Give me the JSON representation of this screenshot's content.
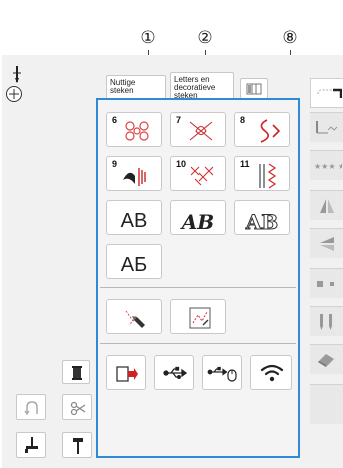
{
  "callouts": [
    "①",
    "②",
    "⑧"
  ],
  "top_tabs": {
    "utility": "Nuttige\nsteken",
    "letters": "Letters en\ndecoratieve\nsteken"
  },
  "stitch_categories": [
    {
      "number": "6",
      "icon": "decorative-flower-stitch-icon"
    },
    {
      "number": "7",
      "icon": "decorative-heart-stitch-icon"
    },
    {
      "number": "8",
      "icon": "decorative-scroll-stitch-icon"
    },
    {
      "number": "9",
      "icon": "satin-stitch-icon"
    },
    {
      "number": "10",
      "icon": "cross-stitch-icon"
    },
    {
      "number": "11",
      "icon": "zigzag-stitch-icon"
    }
  ],
  "fonts": [
    {
      "label": "AB",
      "style": "block"
    },
    {
      "label": "AB",
      "style": "script"
    },
    {
      "label": "AB",
      "style": "outline"
    },
    {
      "label": "АБ",
      "style": "cyrillic"
    }
  ],
  "icons": {
    "design": "stitch-design-pen-icon",
    "my_design": "my-design-center-icon",
    "memory": "pocket-memory-icon",
    "usb": "usb-icon",
    "usb_mouse": "usb-mouse-icon",
    "wireless": "wifi-icon"
  }
}
